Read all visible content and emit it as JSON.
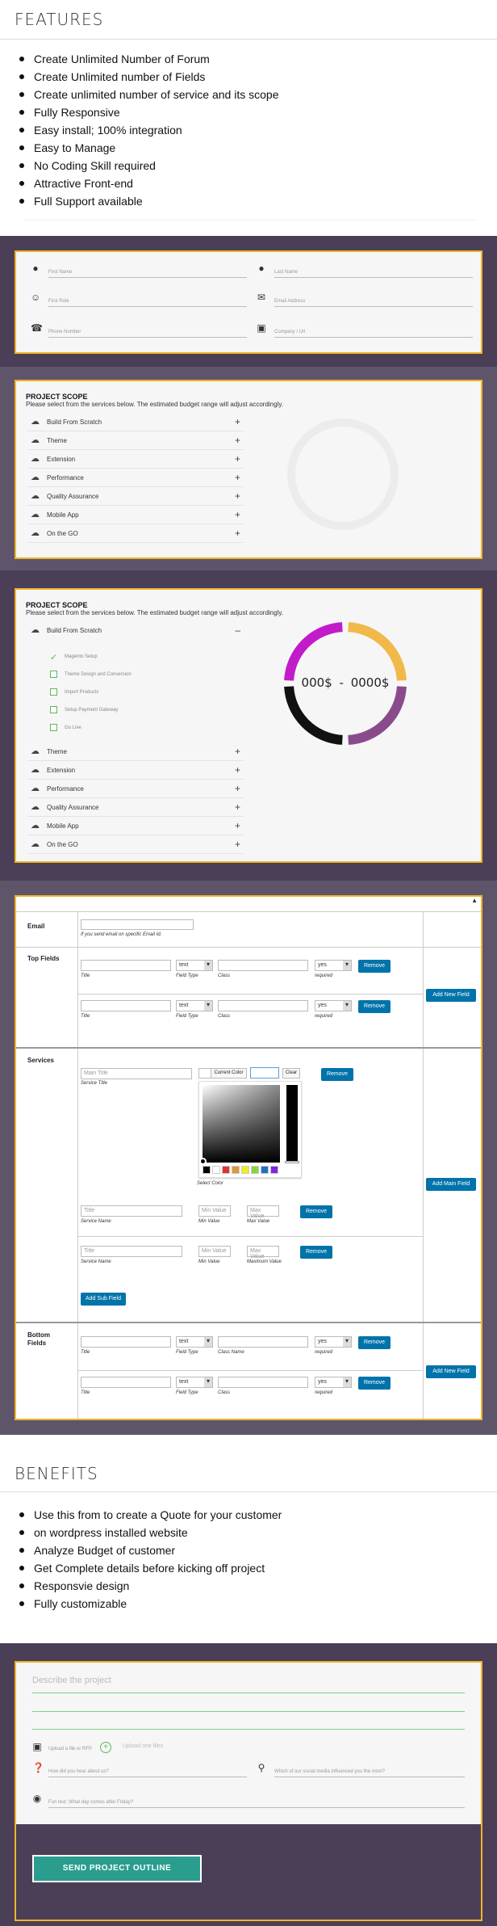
{
  "features": {
    "title": "FEATURES",
    "items": [
      "Create Unlimited Number of Forum",
      "Create Unlimited number of Fields",
      "Create unlimited number of service and its scope",
      "Fully Responsive",
      "Easy install; 100% integration",
      "Easy to Manage",
      "No Coding Skill required",
      "Attractive Front-end",
      "Full Support available"
    ]
  },
  "contact_form": {
    "first_name": "First Name",
    "last_name": "Last Name",
    "first_role": "First Role",
    "email": "Email Address",
    "phone": "Phone Number",
    "company": "Company / Url"
  },
  "scope1": {
    "title": "PROJECT SCOPE",
    "subtitle": "Please select from the services below. The estimated budget range will adjust accordingly.",
    "services": [
      "Build From Scratch",
      "Theme",
      "Extension",
      "Performance",
      "Quality Assurance",
      "Mobile App",
      "On the GO"
    ]
  },
  "scope2": {
    "title": "PROJECT SCOPE",
    "subtitle": "Please select from the services below. The estimated budget range will adjust accordingly.",
    "expanded": "Build From Scratch",
    "subitems": [
      "Magento Setup",
      "Theme Design and Conversion",
      "Import Products",
      "Setup Payment Gateway",
      "Go Live"
    ],
    "services": [
      "Theme",
      "Extension",
      "Performance",
      "Quality Assurance",
      "Mobile App",
      "On the GO"
    ],
    "budget_min": "000$",
    "budget_sep": "-",
    "budget_max": "0000$",
    "ring_colors": [
      "#f0b94a",
      "#8a4b8c",
      "#111111",
      "#c21bc9"
    ]
  },
  "admin": {
    "email_label": "Email",
    "email_help": "If you send email on specific Email Id.",
    "top_fields_label": "Top Fields",
    "services_label": "Services",
    "bottom_fields_label": [
      "Bottom",
      "Fields"
    ],
    "title_cap": "Title",
    "field_type_cap": "Field Type",
    "class_cap": "Class",
    "class_name_cap": "Class Name",
    "required_cap": "required",
    "select_text": "text",
    "select_yes": "yes",
    "remove": "Remove",
    "add_new_field": "Add New Field",
    "add_main_field": "Add Main Field",
    "add_sub_field": "Add Sub Field",
    "main_title_ph": "Main Title",
    "service_title_cap": "Service Title",
    "current_color": "Current Color",
    "clear": "Clear",
    "select_color": "Select Color",
    "title_ph": "Title",
    "service_name_cap": "Service Name",
    "min_value_ph": "Min Value",
    "max_value_ph": "Max Value",
    "min_value_cap": "Min Value",
    "max_value_cap": "Max Value",
    "maximum_value_cap": "Maximum Value",
    "swatches": [
      "#000000",
      "#ffffff",
      "#dd3333",
      "#dd9933",
      "#eeee22",
      "#81d742",
      "#1e73be",
      "#8224e3"
    ]
  },
  "benefits": {
    "title": "BENEFITS",
    "items": [
      "Use this from to create a Quote for your customer",
      "on wordpress installed website",
      "Analyze Budget of customer",
      "Get Complete details before kicking off project",
      "Responsvie design",
      "Fully customizable"
    ]
  },
  "project_form": {
    "describe_ph": "Describe the project",
    "upload_label": "Upload a file or RFP",
    "upload_files": "Upload one files",
    "hear_about": "How did you hear about us?",
    "social_media": "Which of our social media influenced you the most?",
    "fun_test": "Fun test: What day comes after Friday?",
    "send": "SEND PROJECT OUTLINE"
  }
}
